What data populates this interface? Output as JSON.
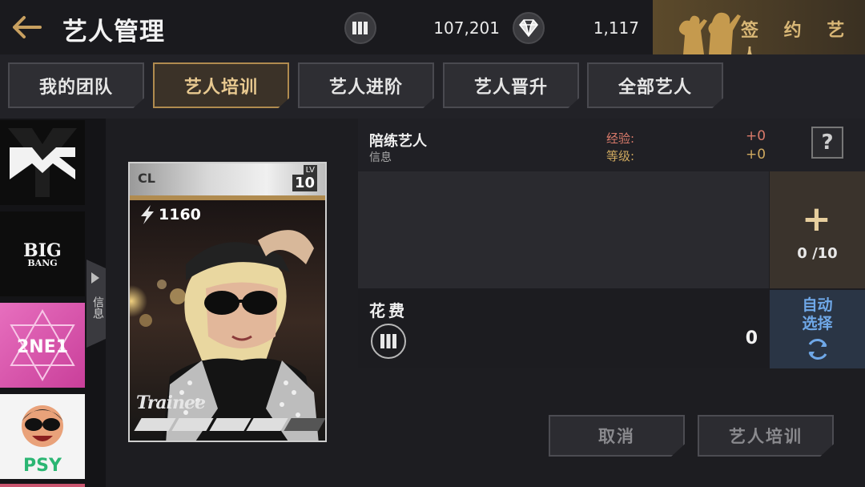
{
  "header": {
    "title": "艺人管理",
    "currency1_value": "107,201",
    "currency2_value": "1,117",
    "sign_label": "签 约 艺 人"
  },
  "tabs": [
    {
      "label": "我的团队"
    },
    {
      "label": "艺人培训"
    },
    {
      "label": "艺人进阶"
    },
    {
      "label": "艺人晋升"
    },
    {
      "label": "全部艺人"
    }
  ],
  "sidebar": {
    "handle_label": "信息",
    "labels": {
      "bigbang_1": "BIG",
      "bigbang_2": "BANG",
      "twone1": "2NE1",
      "psy": "PSY"
    }
  },
  "card": {
    "grade": "CL",
    "lv_label": "LV",
    "level": "10",
    "power": "1160",
    "brand": "Trainee"
  },
  "info": {
    "name": "陪练艺人",
    "sub": "信息",
    "exp_label": "经验:",
    "level_label": "等级:",
    "exp_value": "+0",
    "level_value": "+0",
    "help": "?"
  },
  "slots": {
    "plus": "+",
    "count": "0 /10"
  },
  "cost": {
    "label": "花费",
    "value": "0"
  },
  "auto_select": {
    "line1": "自动",
    "line2": "选择"
  },
  "buttons": {
    "cancel": "取消",
    "train": "艺人培训"
  },
  "colors": {
    "accent_gold": "#b08b4f",
    "auto_blue": "#6fa8e8",
    "exp_red": "#d97a6a"
  }
}
